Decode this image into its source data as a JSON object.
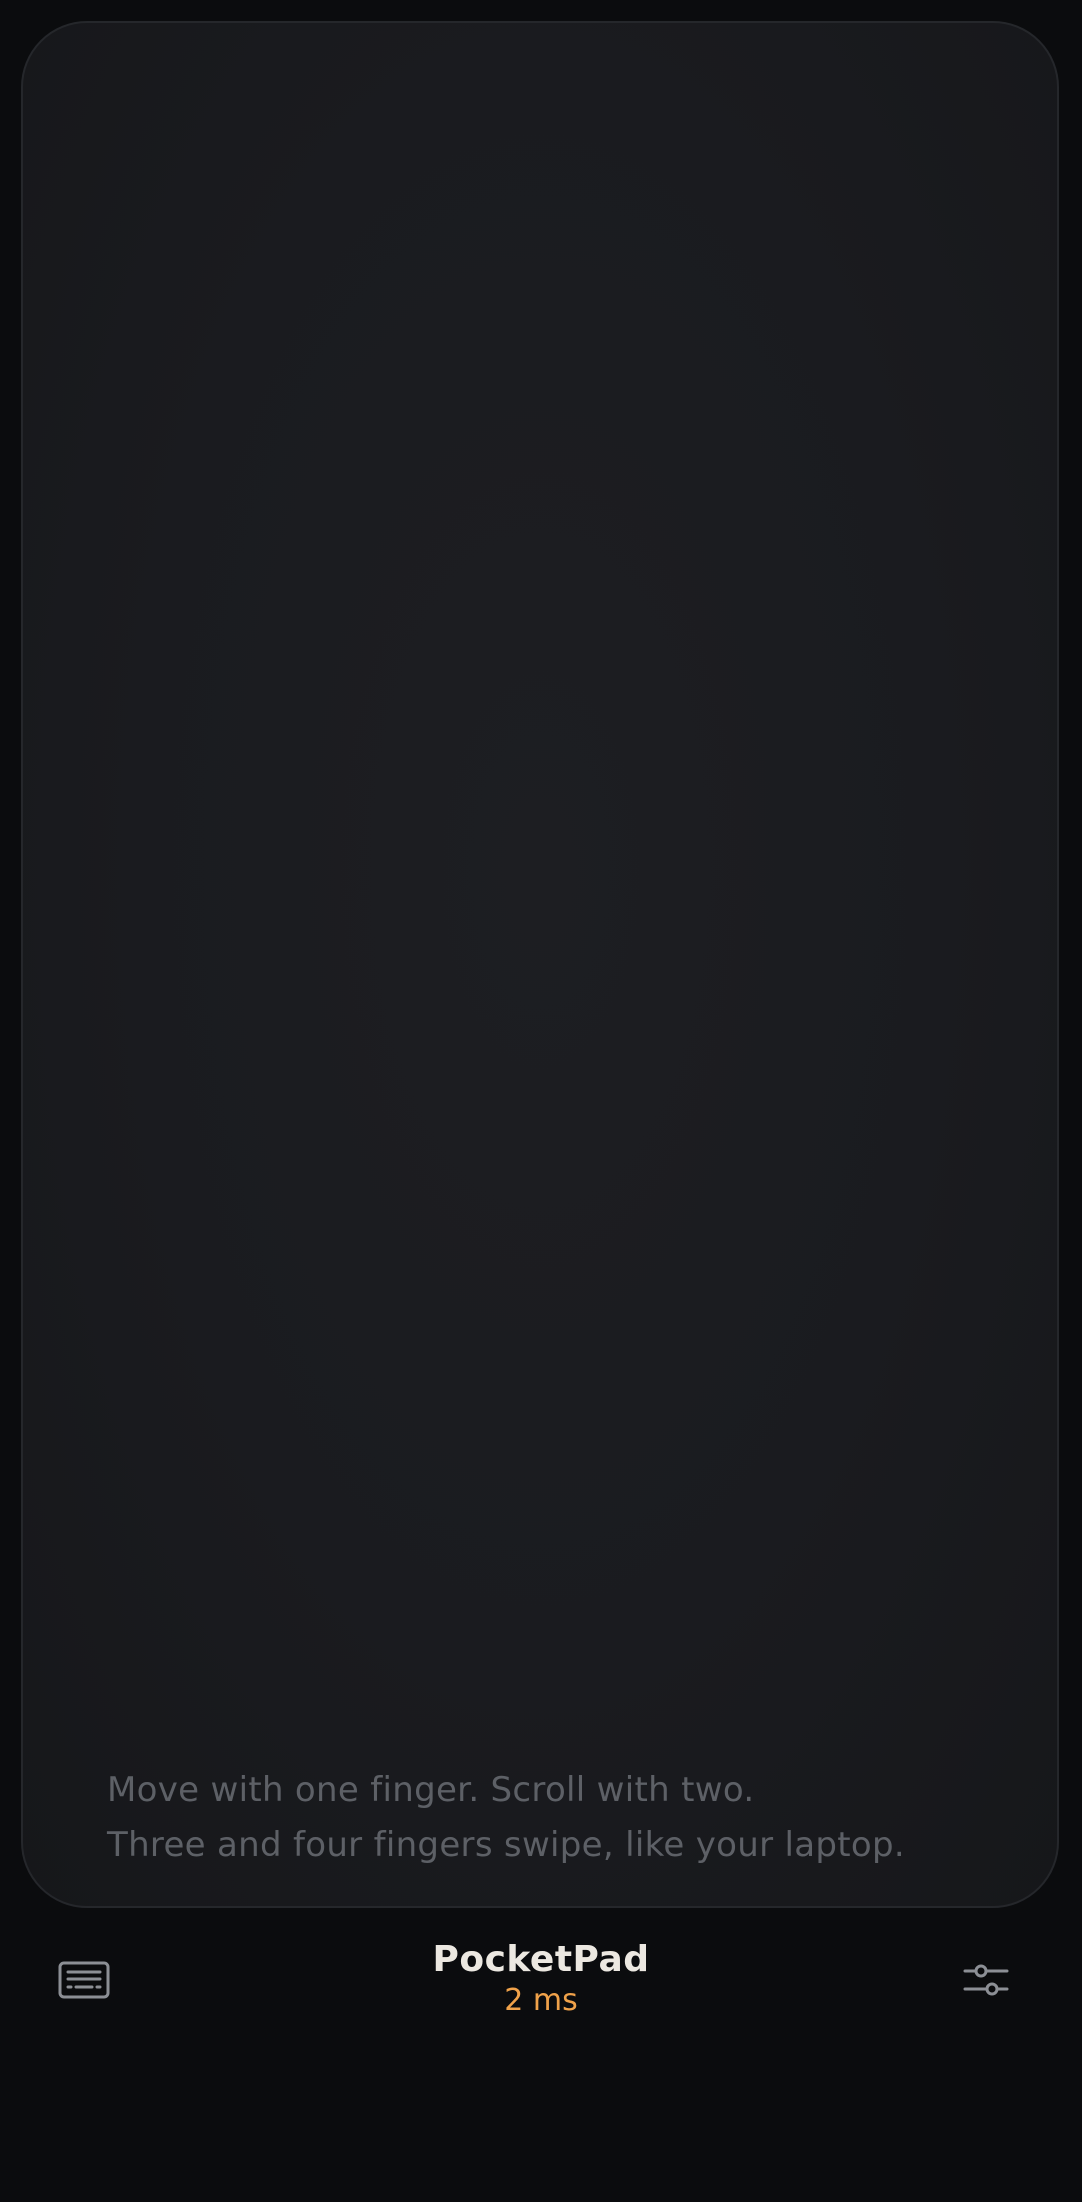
{
  "trackpad": {
    "hint_line_1": "Move with one finger. Scroll with two.",
    "hint_line_2": "Three and four fingers swipe, like your laptop."
  },
  "footer": {
    "app_title": "PocketPad",
    "latency": "2 ms",
    "keyboard_icon": "keyboard-icon",
    "settings_icon": "sliders-icon"
  },
  "colors": {
    "background": "#0b0c0e",
    "surface": "#1a1b1f",
    "accent": "#f0a24a",
    "title": "#ece8e1",
    "hint_text": "#5d6066",
    "icon": "#8c8f95"
  }
}
